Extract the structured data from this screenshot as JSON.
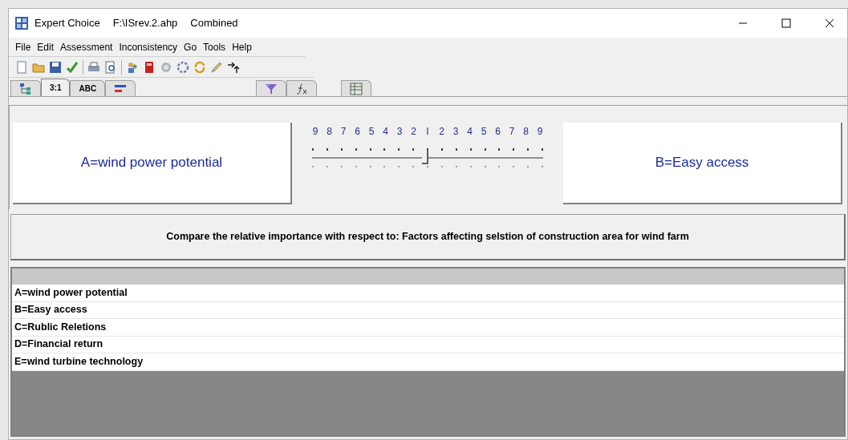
{
  "window": {
    "title": "Expert Choice",
    "file": "F:\\ISrev.2.ahp",
    "mode": "Combined"
  },
  "menu": [
    "File",
    "Edit",
    "Assessment",
    "Inconsistency",
    "Go",
    "Tools",
    "Help"
  ],
  "tabs": [
    {
      "kind": "tree",
      "selected": false
    },
    {
      "kind": "text",
      "label": "3:1",
      "selected": true
    },
    {
      "kind": "text",
      "label": "ABC",
      "selected": false
    },
    {
      "kind": "bars",
      "selected": false
    },
    {
      "kind": "funnel",
      "selected": false
    },
    {
      "kind": "formula",
      "selected": false
    },
    {
      "kind": "grid",
      "selected": false
    }
  ],
  "comparison": {
    "left": "A=wind power potential",
    "right": "B=Easy access",
    "scale": [
      "9",
      "8",
      "7",
      "6",
      "5",
      "4",
      "3",
      "2",
      "I",
      "2",
      "3",
      "4",
      "5",
      "6",
      "7",
      "8",
      "9"
    ],
    "level": 0.5
  },
  "prompt": "Compare the relative importance with respect to: Factors affecting selstion of construction area for wind farm",
  "elements": [
    "A=wind power potential",
    "B=Easy access",
    "C=Rublic Reletions",
    "D=Financial return",
    "E=wind turbine technology"
  ]
}
